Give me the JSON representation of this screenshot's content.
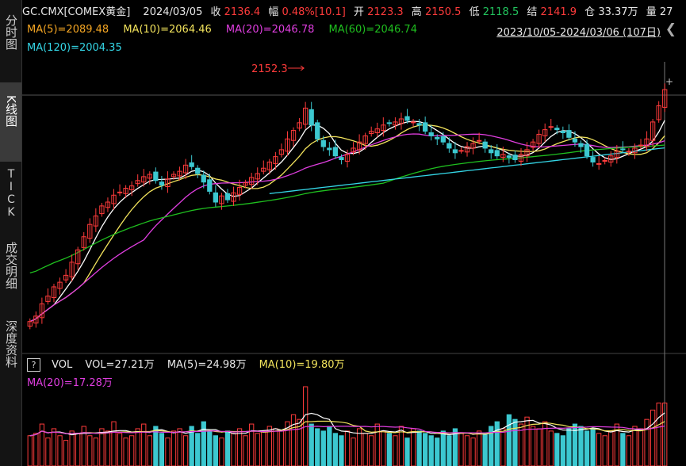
{
  "left_tabs": [
    {
      "label": "分时图",
      "active": false
    },
    {
      "label": "K线图",
      "active": true
    },
    {
      "label": "TICK",
      "active": false
    },
    {
      "label": "成交明细",
      "active": false
    },
    {
      "label": "深度资料",
      "active": false
    }
  ],
  "header": {
    "symbol": "GC.CMX[COMEX黄金]",
    "date": "2024/03/05",
    "close_label": "收",
    "close_value": "2136.4",
    "change_label": "幅",
    "change_value": "0.48%[10.1]",
    "open_label": "开",
    "open_value": "2123.3",
    "high_label": "高",
    "high_value": "2150.5",
    "low_label": "低",
    "low_value": "2118.5",
    "settle_label": "结",
    "settle_value": "2141.9",
    "oi_label": "仓",
    "oi_value": "33.37万",
    "vol_label": "量",
    "vol_value": "27"
  },
  "ma_legend": {
    "ma5": "MA(5)=2089.48",
    "ma10": "MA(10)=2064.46",
    "ma20": "MA(20)=2046.78",
    "ma60": "MA(60)=2046.74",
    "ma120": "MA(120)=2004.35"
  },
  "range_label": "2023/10/05-2024/03/06 (107日)",
  "max_label": "2152.3",
  "volume_legend": {
    "help": "?",
    "vol": "VOL",
    "vol_value": "VOL=27.21万",
    "ma5": "MA(5)=24.98万",
    "ma10": "MA(10)=19.80万",
    "ma20": "MA(20)=17.28万"
  },
  "colors": {
    "up": "#ff3b3b",
    "down": "#3cc8d0",
    "ma5": "#ffffff",
    "ma10": "#f2e35c",
    "ma20": "#e03ee0",
    "ma60": "#1fbf1f",
    "ma120": "#34d6e6"
  },
  "chart_data": {
    "type": "candlestick",
    "closes": [
      1835,
      1842,
      1858,
      1868,
      1880,
      1886,
      1895,
      1912,
      1928,
      1945,
      1961,
      1972,
      1985,
      1990,
      1999,
      2003,
      2008,
      2011,
      2018,
      2023,
      2026,
      2018,
      2012,
      2020,
      2026,
      2030,
      2038,
      2036,
      2027,
      2016,
      2004,
      1990,
      1998,
      1993,
      2002,
      2009,
      2015,
      2022,
      2027,
      2034,
      2042,
      2049,
      2058,
      2072,
      2083,
      2093,
      2112,
      2090,
      2072,
      2062,
      2058,
      2050,
      2045,
      2052,
      2060,
      2068,
      2076,
      2082,
      2085,
      2090,
      2092,
      2094,
      2098,
      2096,
      2094,
      2090,
      2082,
      2076,
      2072,
      2068,
      2060,
      2054,
      2057,
      2062,
      2066,
      2070,
      2060,
      2054,
      2050,
      2052,
      2048,
      2045,
      2052,
      2058,
      2068,
      2078,
      2084,
      2088,
      2084,
      2080,
      2074,
      2068,
      2062,
      2050,
      2042,
      2040,
      2044,
      2050,
      2056,
      2058,
      2056,
      2060,
      2064,
      2072,
      2094,
      2115,
      2136
    ],
    "ma_lines": [
      {
        "name": "MA(5)",
        "color": "#ffffff"
      },
      {
        "name": "MA(10)",
        "color": "#f2e35c"
      },
      {
        "name": "MA(20)",
        "color": "#e03ee0"
      },
      {
        "name": "MA(60)",
        "color": "#1fbf1f"
      },
      {
        "name": "MA(120)",
        "color": "#34d6e6"
      }
    ],
    "volume": [
      13,
      14,
      18,
      12,
      16,
      13,
      11,
      15,
      14,
      17,
      13,
      12,
      16,
      15,
      19,
      14,
      12,
      13,
      16,
      18,
      13,
      17,
      14,
      12,
      15,
      16,
      13,
      17,
      14,
      19,
      15,
      13,
      12,
      15,
      14,
      16,
      13,
      18,
      14,
      15,
      17,
      16,
      15,
      19,
      22,
      20,
      34,
      18,
      16,
      15,
      17,
      14,
      13,
      15,
      12,
      16,
      14,
      13,
      18,
      15,
      14,
      13,
      17,
      12,
      16,
      15,
      14,
      13,
      12,
      15,
      13,
      16,
      14,
      13,
      12,
      15,
      14,
      17,
      19,
      16,
      22,
      20,
      18,
      21,
      17,
      16,
      19,
      15,
      14,
      13,
      16,
      18,
      17,
      15,
      16,
      14,
      13,
      15,
      18,
      14,
      13,
      17,
      16,
      20,
      24,
      27,
      27
    ]
  }
}
